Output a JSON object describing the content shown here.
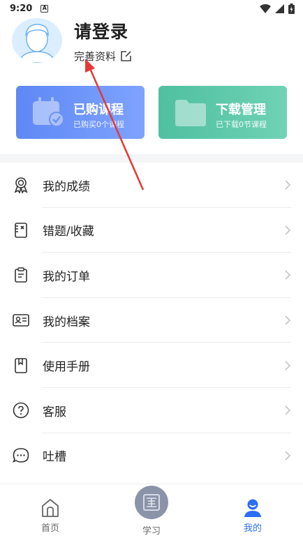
{
  "status_bar": {
    "time": "9:20",
    "badge": "A"
  },
  "profile": {
    "login_title": "请登录",
    "complete_profile": "完善资料"
  },
  "cards": {
    "purchased": {
      "title": "已购课程",
      "subtitle": "已购买0个课程",
      "color_start": "#5e88f5",
      "color_end": "#7ea3ff"
    },
    "download": {
      "title": "下载管理",
      "subtitle": "已下载0节课程",
      "color_start": "#4fc0a0",
      "color_end": "#6fd2b4"
    }
  },
  "menu": {
    "items": [
      {
        "label": "我的成绩",
        "icon": "award-icon"
      },
      {
        "label": "错题/收藏",
        "icon": "notebook-x-icon"
      },
      {
        "label": "我的订单",
        "icon": "clipboard-icon"
      },
      {
        "label": "我的档案",
        "icon": "id-card-icon"
      },
      {
        "label": "使用手册",
        "icon": "book-icon"
      },
      {
        "label": "客服",
        "icon": "help-circle-icon"
      },
      {
        "label": "吐槽",
        "icon": "chat-bubble-icon"
      }
    ]
  },
  "tabbar": {
    "home": "首页",
    "study": "学习",
    "mine": "我的",
    "active_color": "#2d6ff3"
  },
  "annotation_color": "#e53935"
}
